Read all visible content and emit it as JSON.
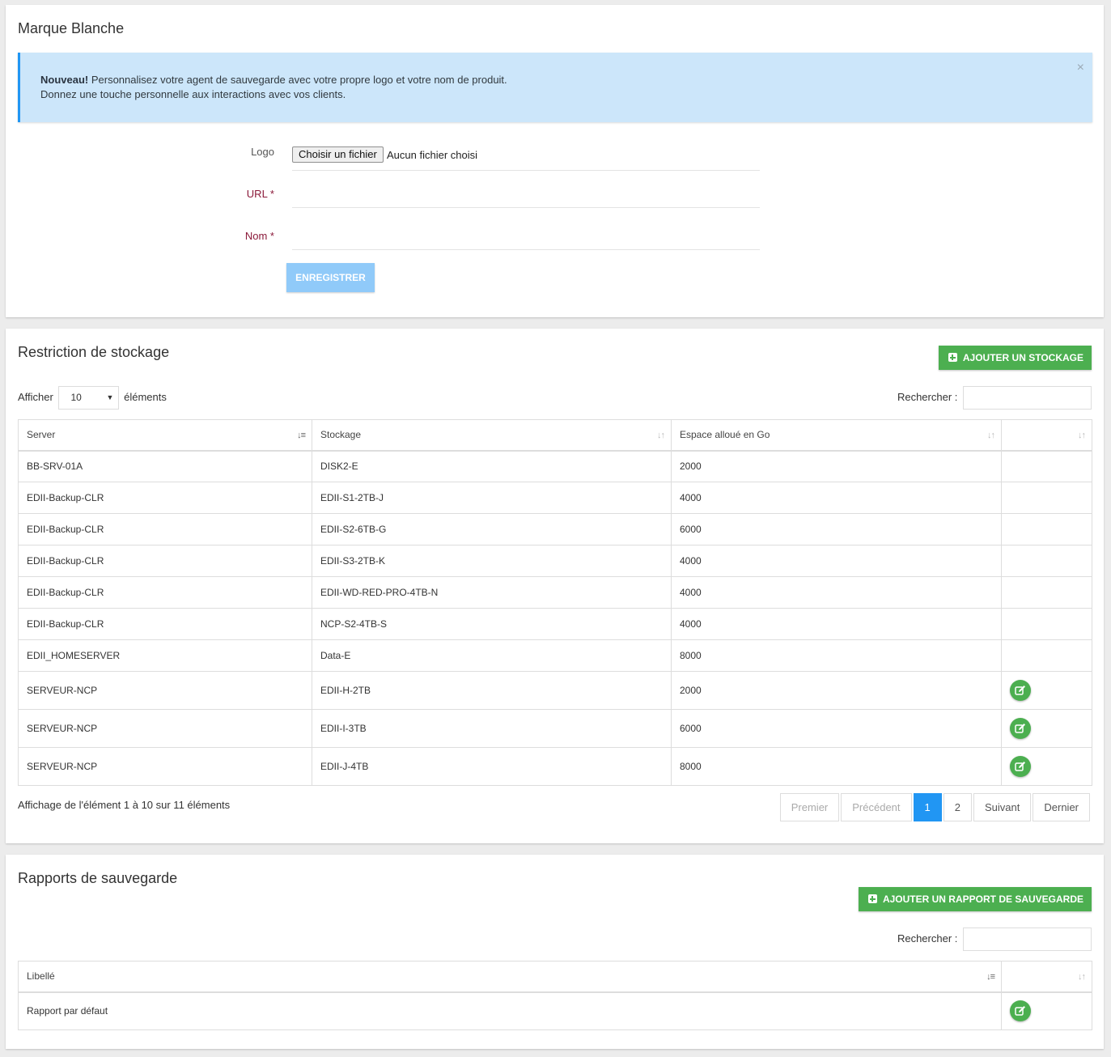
{
  "white_label": {
    "title": "Marque Blanche",
    "alert": {
      "strong": "Nouveau!",
      "line1": " Personnalisez votre agent de sauvegarde avec votre propre logo et votre nom de produit.",
      "line2": "Donnez une touche personnelle aux interactions avec vos clients.",
      "close": "×"
    },
    "logo_label": "Logo",
    "file_button": "Choisir un fichier",
    "file_status": "Aucun fichier choisi",
    "url_label": "URL *",
    "url_value": "",
    "name_label": "Nom *",
    "name_value": "",
    "save_label": "ENREGISTRER"
  },
  "storage": {
    "title": "Restriction de stockage",
    "add_label": "AJOUTER UN STOCKAGE",
    "show_prefix": "Afficher",
    "show_value": "10",
    "show_suffix": "éléments",
    "search_label": "Rechercher :",
    "search_value": "",
    "columns": [
      "Server",
      "Stockage",
      "Espace alloué en Go",
      ""
    ],
    "rows": [
      {
        "server": "BB-SRV-01A",
        "storage": "DISK2-E",
        "space": "2000",
        "edit": false
      },
      {
        "server": "EDII-Backup-CLR",
        "storage": "EDII-S1-2TB-J",
        "space": "4000",
        "edit": false
      },
      {
        "server": "EDII-Backup-CLR",
        "storage": "EDII-S2-6TB-G",
        "space": "6000",
        "edit": false
      },
      {
        "server": "EDII-Backup-CLR",
        "storage": "EDII-S3-2TB-K",
        "space": "4000",
        "edit": false
      },
      {
        "server": "EDII-Backup-CLR",
        "storage": "EDII-WD-RED-PRO-4TB-N",
        "space": "4000",
        "edit": false
      },
      {
        "server": "EDII-Backup-CLR",
        "storage": "NCP-S2-4TB-S",
        "space": "4000",
        "edit": false
      },
      {
        "server": "EDII_HOMESERVER",
        "storage": "Data-E",
        "space": "8000",
        "edit": false
      },
      {
        "server": "SERVEUR-NCP",
        "storage": "EDII-H-2TB",
        "space": "2000",
        "edit": true
      },
      {
        "server": "SERVEUR-NCP",
        "storage": "EDII-I-3TB",
        "space": "6000",
        "edit": true
      },
      {
        "server": "SERVEUR-NCP",
        "storage": "EDII-J-4TB",
        "space": "8000",
        "edit": true
      }
    ],
    "info": "Affichage de l'élément 1 à 10 sur 11 éléments",
    "pagination": {
      "first": "Premier",
      "prev": "Précédent",
      "pages": [
        "1",
        "2"
      ],
      "current": "1",
      "next": "Suivant",
      "last": "Dernier"
    }
  },
  "reports": {
    "title": "Rapports de sauvegarde",
    "add_label": "AJOUTER UN RAPPORT DE SAUVEGARDE",
    "search_label": "Rechercher :",
    "search_value": "",
    "columns": [
      "Libellé",
      ""
    ],
    "rows": [
      {
        "label": "Rapport par défaut",
        "edit": true
      }
    ]
  },
  "icons": {
    "add": "plus-square-icon",
    "edit": "edit-icon",
    "sort": "sort-icon",
    "close": "close-icon"
  },
  "colors": {
    "primary": "#2196f3",
    "success": "#4caf50",
    "alert_bg": "#cce6fa",
    "save_disabled": "#90caf9",
    "required": "#8b1a3a"
  }
}
